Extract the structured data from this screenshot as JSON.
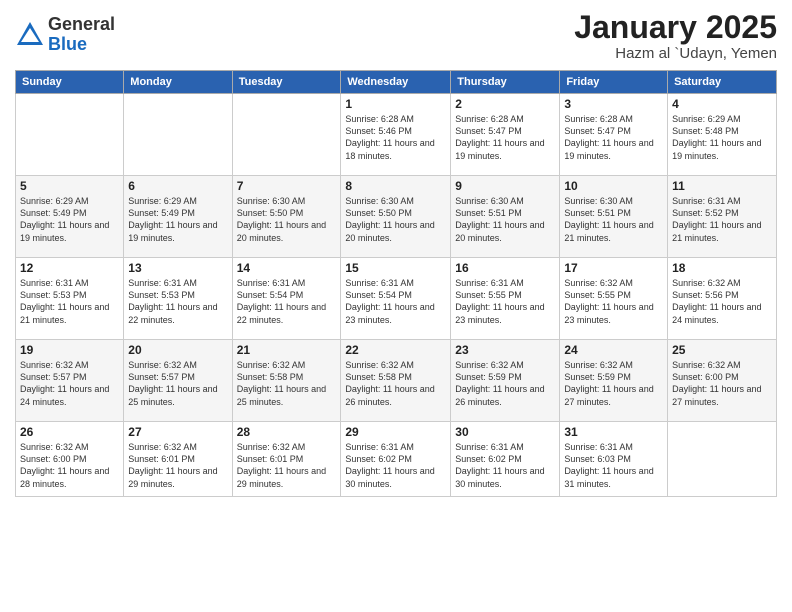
{
  "logo": {
    "general": "General",
    "blue": "Blue"
  },
  "title": "January 2025",
  "location": "Hazm al `Udayn, Yemen",
  "days_of_week": [
    "Sunday",
    "Monday",
    "Tuesday",
    "Wednesday",
    "Thursday",
    "Friday",
    "Saturday"
  ],
  "weeks": [
    [
      {
        "num": "",
        "sunrise": "",
        "sunset": "",
        "daylight": ""
      },
      {
        "num": "",
        "sunrise": "",
        "sunset": "",
        "daylight": ""
      },
      {
        "num": "",
        "sunrise": "",
        "sunset": "",
        "daylight": ""
      },
      {
        "num": "1",
        "sunrise": "Sunrise: 6:28 AM",
        "sunset": "Sunset: 5:46 PM",
        "daylight": "Daylight: 11 hours and 18 minutes."
      },
      {
        "num": "2",
        "sunrise": "Sunrise: 6:28 AM",
        "sunset": "Sunset: 5:47 PM",
        "daylight": "Daylight: 11 hours and 19 minutes."
      },
      {
        "num": "3",
        "sunrise": "Sunrise: 6:28 AM",
        "sunset": "Sunset: 5:47 PM",
        "daylight": "Daylight: 11 hours and 19 minutes."
      },
      {
        "num": "4",
        "sunrise": "Sunrise: 6:29 AM",
        "sunset": "Sunset: 5:48 PM",
        "daylight": "Daylight: 11 hours and 19 minutes."
      }
    ],
    [
      {
        "num": "5",
        "sunrise": "Sunrise: 6:29 AM",
        "sunset": "Sunset: 5:49 PM",
        "daylight": "Daylight: 11 hours and 19 minutes."
      },
      {
        "num": "6",
        "sunrise": "Sunrise: 6:29 AM",
        "sunset": "Sunset: 5:49 PM",
        "daylight": "Daylight: 11 hours and 19 minutes."
      },
      {
        "num": "7",
        "sunrise": "Sunrise: 6:30 AM",
        "sunset": "Sunset: 5:50 PM",
        "daylight": "Daylight: 11 hours and 20 minutes."
      },
      {
        "num": "8",
        "sunrise": "Sunrise: 6:30 AM",
        "sunset": "Sunset: 5:50 PM",
        "daylight": "Daylight: 11 hours and 20 minutes."
      },
      {
        "num": "9",
        "sunrise": "Sunrise: 6:30 AM",
        "sunset": "Sunset: 5:51 PM",
        "daylight": "Daylight: 11 hours and 20 minutes."
      },
      {
        "num": "10",
        "sunrise": "Sunrise: 6:30 AM",
        "sunset": "Sunset: 5:51 PM",
        "daylight": "Daylight: 11 hours and 21 minutes."
      },
      {
        "num": "11",
        "sunrise": "Sunrise: 6:31 AM",
        "sunset": "Sunset: 5:52 PM",
        "daylight": "Daylight: 11 hours and 21 minutes."
      }
    ],
    [
      {
        "num": "12",
        "sunrise": "Sunrise: 6:31 AM",
        "sunset": "Sunset: 5:53 PM",
        "daylight": "Daylight: 11 hours and 21 minutes."
      },
      {
        "num": "13",
        "sunrise": "Sunrise: 6:31 AM",
        "sunset": "Sunset: 5:53 PM",
        "daylight": "Daylight: 11 hours and 22 minutes."
      },
      {
        "num": "14",
        "sunrise": "Sunrise: 6:31 AM",
        "sunset": "Sunset: 5:54 PM",
        "daylight": "Daylight: 11 hours and 22 minutes."
      },
      {
        "num": "15",
        "sunrise": "Sunrise: 6:31 AM",
        "sunset": "Sunset: 5:54 PM",
        "daylight": "Daylight: 11 hours and 23 minutes."
      },
      {
        "num": "16",
        "sunrise": "Sunrise: 6:31 AM",
        "sunset": "Sunset: 5:55 PM",
        "daylight": "Daylight: 11 hours and 23 minutes."
      },
      {
        "num": "17",
        "sunrise": "Sunrise: 6:32 AM",
        "sunset": "Sunset: 5:55 PM",
        "daylight": "Daylight: 11 hours and 23 minutes."
      },
      {
        "num": "18",
        "sunrise": "Sunrise: 6:32 AM",
        "sunset": "Sunset: 5:56 PM",
        "daylight": "Daylight: 11 hours and 24 minutes."
      }
    ],
    [
      {
        "num": "19",
        "sunrise": "Sunrise: 6:32 AM",
        "sunset": "Sunset: 5:57 PM",
        "daylight": "Daylight: 11 hours and 24 minutes."
      },
      {
        "num": "20",
        "sunrise": "Sunrise: 6:32 AM",
        "sunset": "Sunset: 5:57 PM",
        "daylight": "Daylight: 11 hours and 25 minutes."
      },
      {
        "num": "21",
        "sunrise": "Sunrise: 6:32 AM",
        "sunset": "Sunset: 5:58 PM",
        "daylight": "Daylight: 11 hours and 25 minutes."
      },
      {
        "num": "22",
        "sunrise": "Sunrise: 6:32 AM",
        "sunset": "Sunset: 5:58 PM",
        "daylight": "Daylight: 11 hours and 26 minutes."
      },
      {
        "num": "23",
        "sunrise": "Sunrise: 6:32 AM",
        "sunset": "Sunset: 5:59 PM",
        "daylight": "Daylight: 11 hours and 26 minutes."
      },
      {
        "num": "24",
        "sunrise": "Sunrise: 6:32 AM",
        "sunset": "Sunset: 5:59 PM",
        "daylight": "Daylight: 11 hours and 27 minutes."
      },
      {
        "num": "25",
        "sunrise": "Sunrise: 6:32 AM",
        "sunset": "Sunset: 6:00 PM",
        "daylight": "Daylight: 11 hours and 27 minutes."
      }
    ],
    [
      {
        "num": "26",
        "sunrise": "Sunrise: 6:32 AM",
        "sunset": "Sunset: 6:00 PM",
        "daylight": "Daylight: 11 hours and 28 minutes."
      },
      {
        "num": "27",
        "sunrise": "Sunrise: 6:32 AM",
        "sunset": "Sunset: 6:01 PM",
        "daylight": "Daylight: 11 hours and 29 minutes."
      },
      {
        "num": "28",
        "sunrise": "Sunrise: 6:32 AM",
        "sunset": "Sunset: 6:01 PM",
        "daylight": "Daylight: 11 hours and 29 minutes."
      },
      {
        "num": "29",
        "sunrise": "Sunrise: 6:31 AM",
        "sunset": "Sunset: 6:02 PM",
        "daylight": "Daylight: 11 hours and 30 minutes."
      },
      {
        "num": "30",
        "sunrise": "Sunrise: 6:31 AM",
        "sunset": "Sunset: 6:02 PM",
        "daylight": "Daylight: 11 hours and 30 minutes."
      },
      {
        "num": "31",
        "sunrise": "Sunrise: 6:31 AM",
        "sunset": "Sunset: 6:03 PM",
        "daylight": "Daylight: 11 hours and 31 minutes."
      },
      {
        "num": "",
        "sunrise": "",
        "sunset": "",
        "daylight": ""
      }
    ]
  ]
}
